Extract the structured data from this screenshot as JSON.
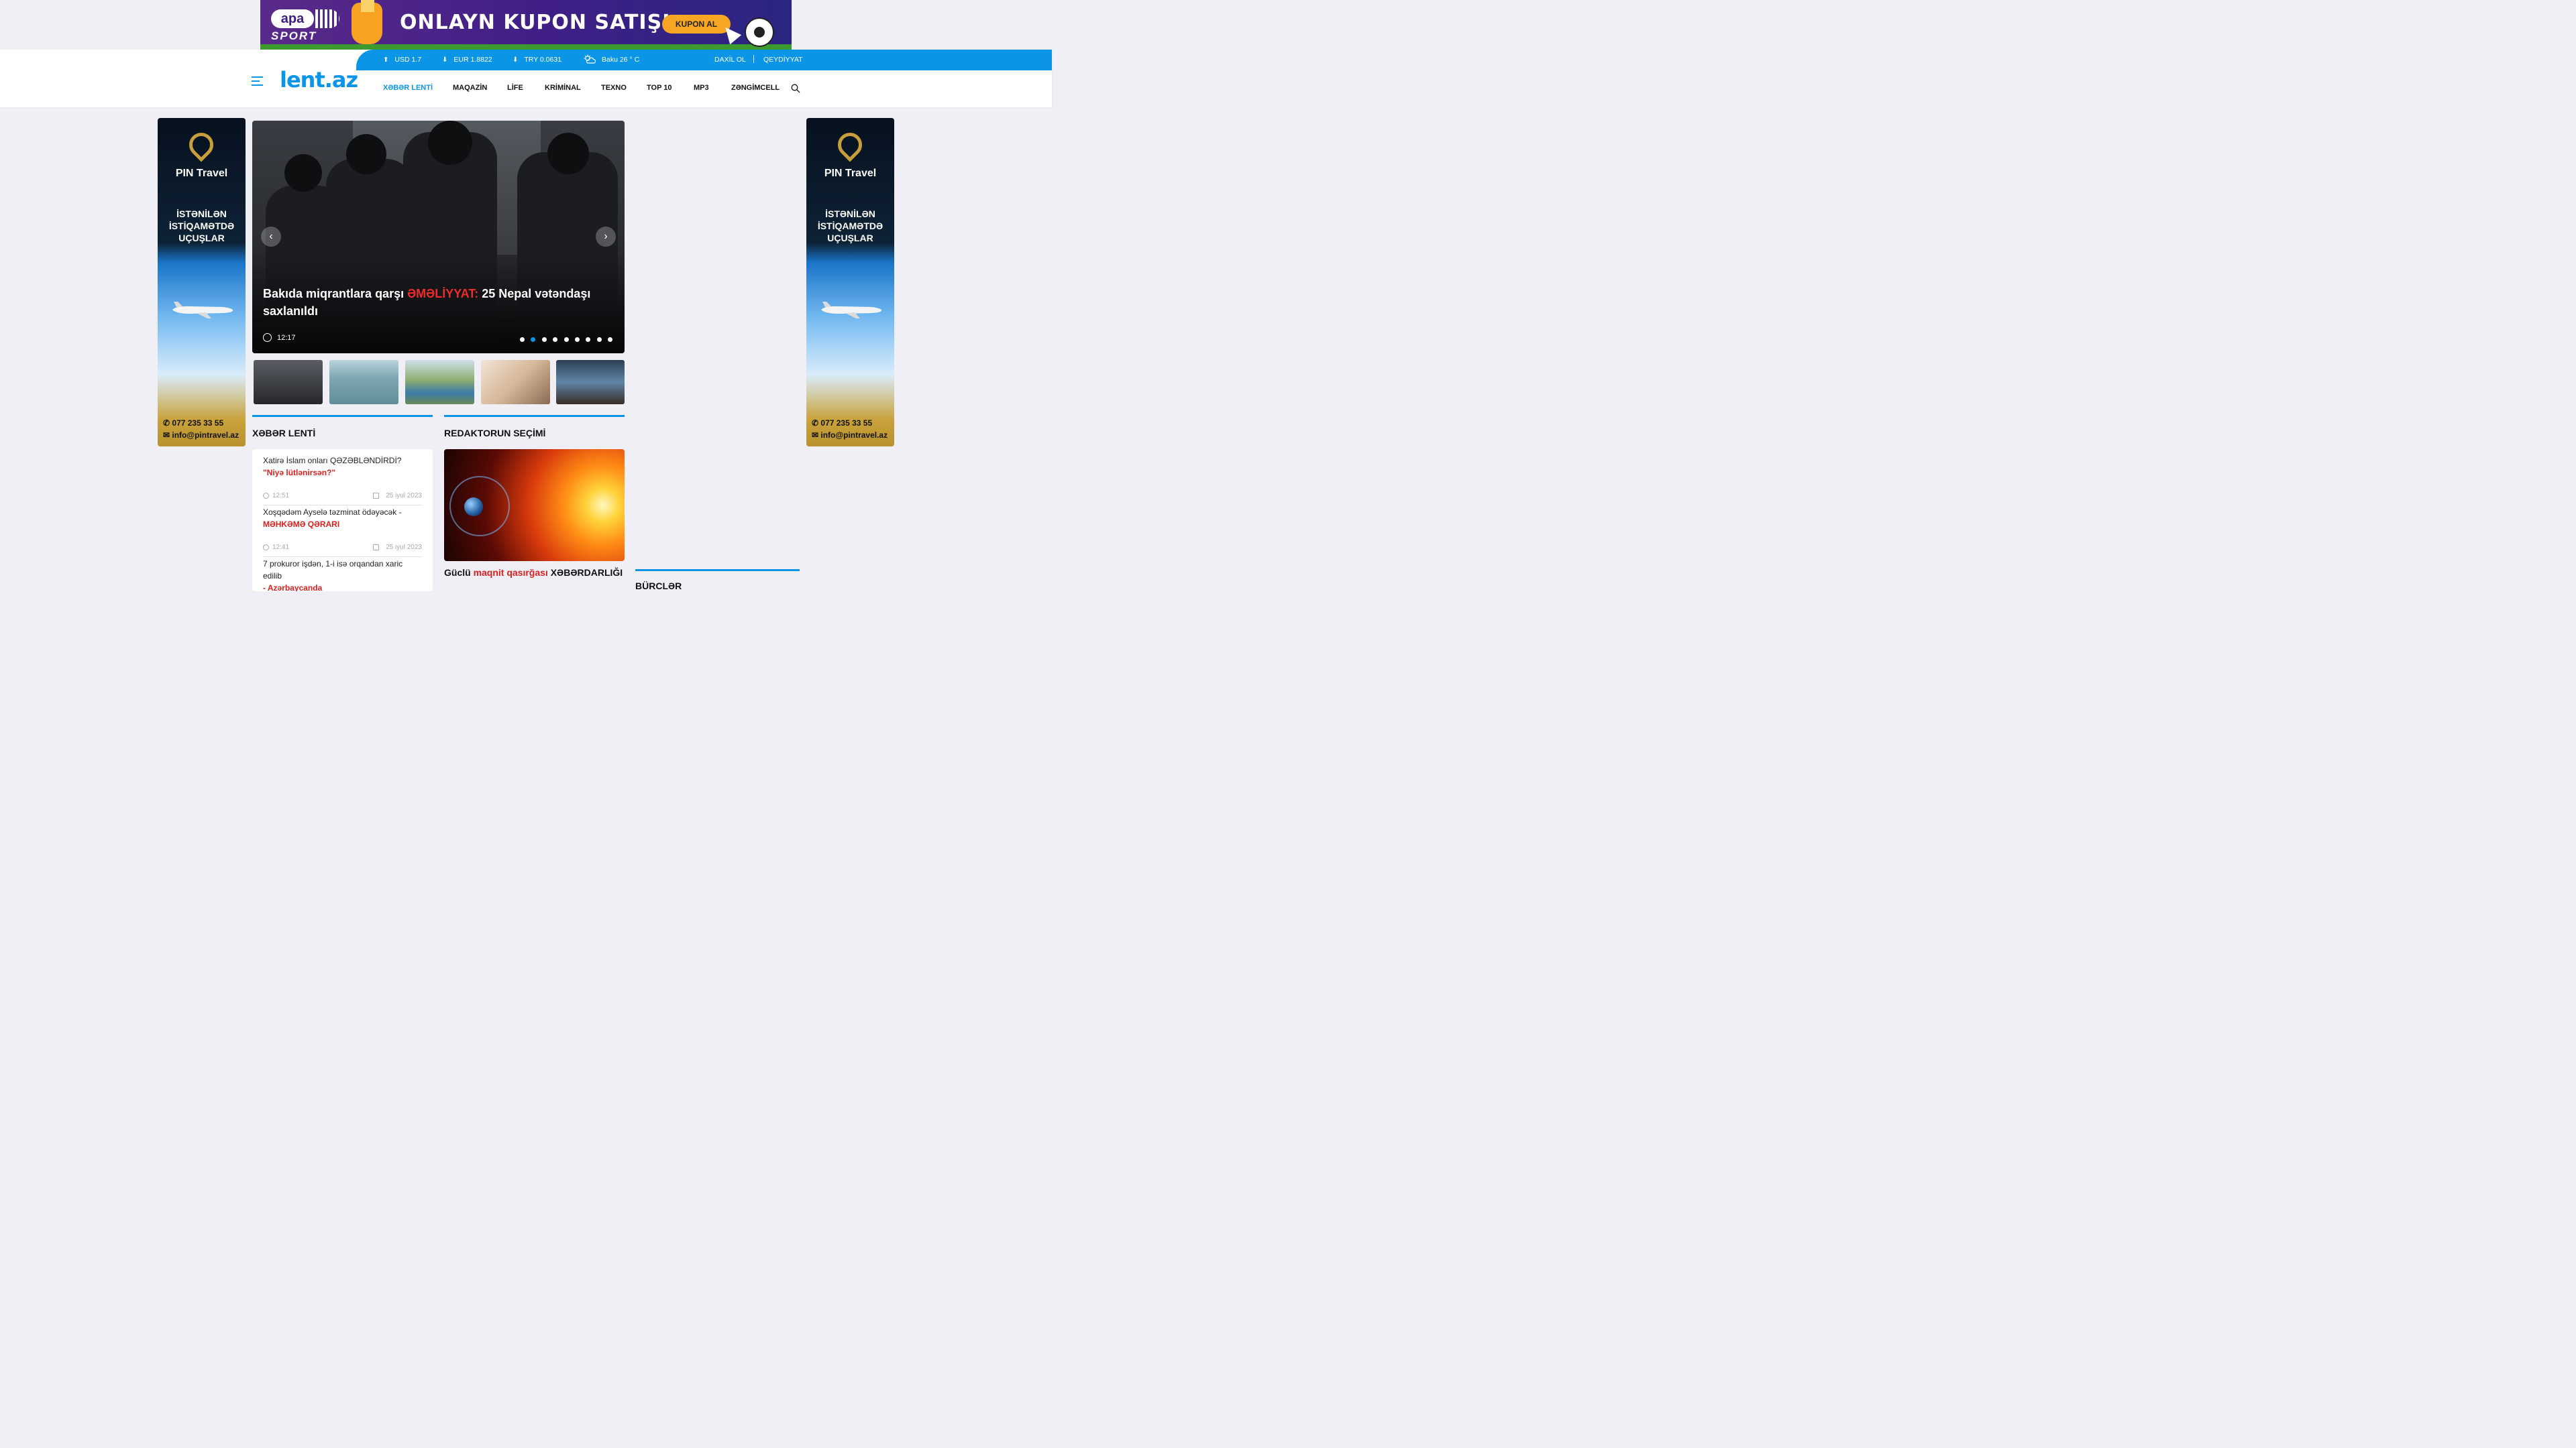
{
  "top_banner": {
    "brand": "apa",
    "brand_sub": "SPORT",
    "headline": "ONLAYN KUPON SATIŞI",
    "cta": "KUPON AL"
  },
  "ticker": {
    "usd": "USD 1.7",
    "eur": "EUR 1.8822",
    "try": "TRY 0.0631",
    "weather": "Baku 26 ° C",
    "login": "DAXİL OL",
    "register": "QEYDİYYAT",
    "up_arrow": "⬆",
    "down_arrow": "⬇"
  },
  "logo": "lent.az",
  "nav": [
    "XƏBƏR LENTİ",
    "MAQAZİN",
    "LİFE",
    "KRİMİNAL",
    "TEXNO",
    "TOP 10",
    "MP3",
    "ZƏNGİMCELL"
  ],
  "side_ad": {
    "brand": "PIN Travel",
    "slogan_lines": [
      "İSTƏNİLƏN",
      "İSTİQAMƏTDƏ",
      "UÇUŞLAR"
    ],
    "phone": "077 235 33 55",
    "email": "info@pintravel.az"
  },
  "slider": {
    "title_part1": "Bakıda miqrantlara qarşı ",
    "title_highlight": "ƏMƏLİYYAT:",
    "title_part2": " 25 Nepal vətəndaşı saxlanıldı",
    "time": "12:17",
    "dots": 9,
    "active_dot": 1,
    "prev": "‹",
    "next": "›"
  },
  "sections": {
    "news_feed": "XƏBƏR LENTİ",
    "editor_pick": "REDAKTORUN SEÇİMİ",
    "horoscope": "BÜRCLƏR"
  },
  "news_items": [
    {
      "line1": "Xatirə İslam onları QƏZƏBLƏNDİRDİ?",
      "line2": "\"Niyə lütlənirsən?\"",
      "time": "12:51",
      "date": "25 iyul 2023"
    },
    {
      "line1": "Xoşqədəm Ayselə təzminat ödəyəcək -",
      "line2": "MƏHKƏMƏ QƏRARI",
      "time": "12:41",
      "date": "25 iyul 2023"
    },
    {
      "line1": "7 prokuror işdən, 1-i isə orqandan xaric edilib",
      "line2": "- Azərbaycanda",
      "time": "",
      "date": ""
    }
  ],
  "editor_pick": {
    "caption_part1": "Güclü ",
    "caption_highlight": "maqnit qasırğası",
    "caption_part2": " XƏBƏRDARLIĞI"
  },
  "colors": {
    "accent": "#0b95e6",
    "highlight": "#d8201e"
  }
}
